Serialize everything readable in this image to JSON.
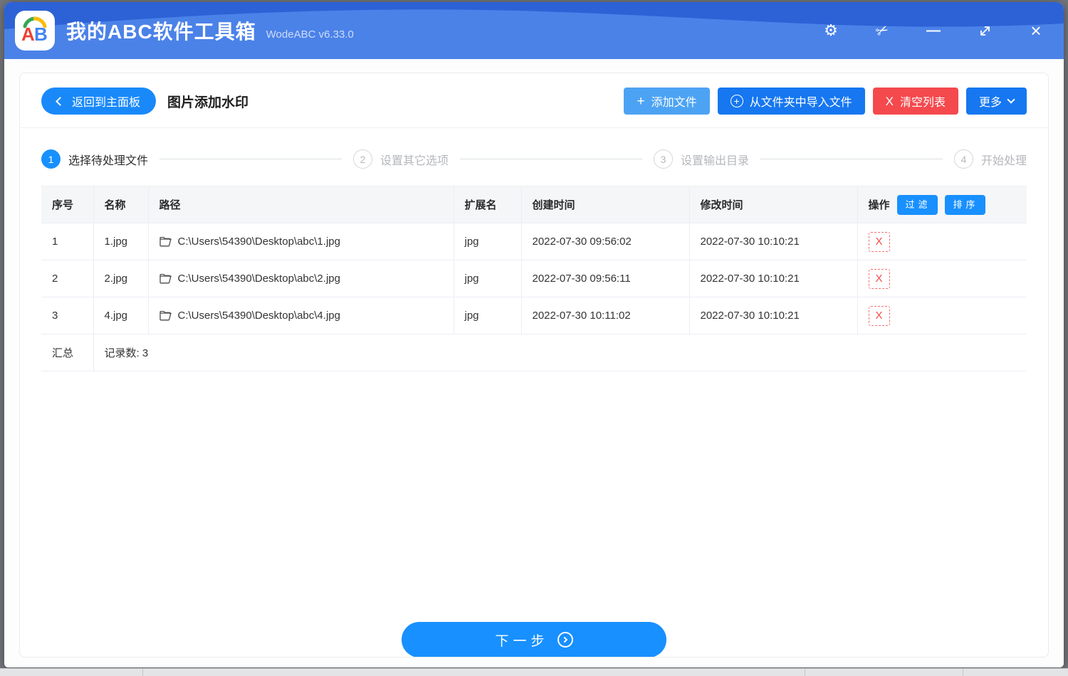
{
  "titlebar": {
    "app_title": "我的ABC软件工具箱",
    "version": "WodeABC v6.33.0",
    "logo_letters": "AB",
    "icons": {
      "gear": "⚙",
      "scissors": "✂",
      "minimize": "—",
      "close": "×"
    }
  },
  "toolbar": {
    "back_label": "返回到主面板",
    "page_title": "图片添加水印",
    "add_files_label": "添加文件",
    "import_folder_label": "从文件夹中导入文件",
    "clear_list_label": "清空列表",
    "clear_icon": "X",
    "more_label": "更多",
    "plus_icon": "+",
    "circle_plus_icon": "+"
  },
  "steps": [
    {
      "num": "1",
      "label": "选择待处理文件"
    },
    {
      "num": "2",
      "label": "设置其它选项"
    },
    {
      "num": "3",
      "label": "设置输出目录"
    },
    {
      "num": "4",
      "label": "开始处理"
    }
  ],
  "table": {
    "headers": {
      "index": "序号",
      "name": "名称",
      "path": "路径",
      "ext": "扩展名",
      "created": "创建时间",
      "modified": "修改时间",
      "op": "操作"
    },
    "filter_btn": "过滤",
    "sort_btn": "排序",
    "delete_icon": "X",
    "rows": [
      {
        "index": "1",
        "name": "1.jpg",
        "path": "C:\\Users\\54390\\Desktop\\abc\\1.jpg",
        "ext": "jpg",
        "created": "2022-07-30 09:56:02",
        "modified": "2022-07-30 10:10:21"
      },
      {
        "index": "2",
        "name": "2.jpg",
        "path": "C:\\Users\\54390\\Desktop\\abc\\2.jpg",
        "ext": "jpg",
        "created": "2022-07-30 09:56:11",
        "modified": "2022-07-30 10:10:21"
      },
      {
        "index": "3",
        "name": "4.jpg",
        "path": "C:\\Users\\54390\\Desktop\\abc\\4.jpg",
        "ext": "jpg",
        "created": "2022-07-30 10:11:02",
        "modified": "2022-07-30 10:10:21"
      }
    ],
    "summary": {
      "label": "汇总",
      "text": "记录数: 3"
    }
  },
  "footer": {
    "next_label": "下一步"
  },
  "colors": {
    "titlebar_top": "#2c62d6",
    "titlebar_wave": "#4b82e8",
    "primary_blue": "#1890ff",
    "button_blue": "#1677f0",
    "button_light_blue": "#4da3f3",
    "button_red": "#f4494d"
  }
}
